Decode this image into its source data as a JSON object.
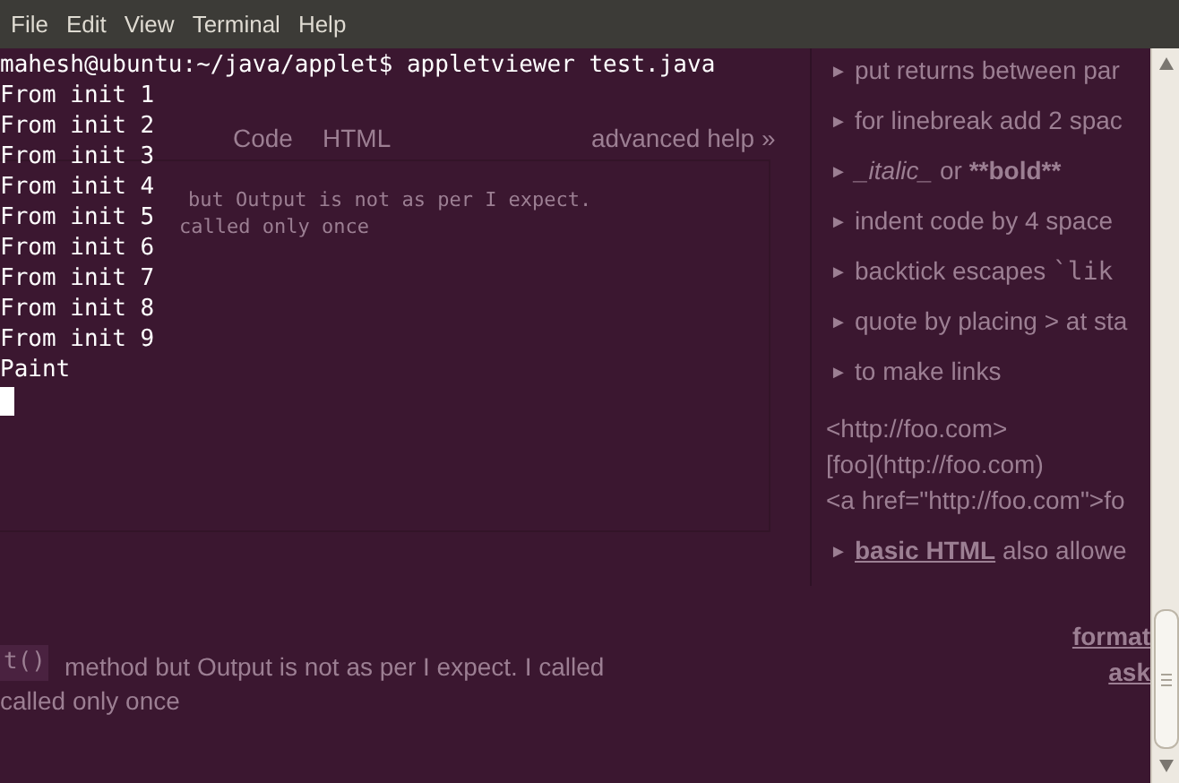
{
  "menu": [
    "File",
    "Edit",
    "View",
    "Terminal",
    "Help"
  ],
  "terminal": {
    "lines": [
      "mahesh@ubuntu:~/java/applet$ appletviewer test.java",
      "From init 1",
      "From init 2",
      "From init 3",
      "From init 4",
      "From init 5",
      "From init 6",
      "From init 7",
      "From init 8",
      "From init 9",
      "Paint"
    ],
    "cursor": true
  },
  "behind": {
    "tabs": [
      "Code",
      "HTML"
    ],
    "advanced_help": "advanced help »",
    "preview_lines": [
      "but Output is not as per I expect.",
      "called only once"
    ],
    "question_code": "t()",
    "question_lines": [
      "method but Output is not as per I expect. I called",
      "called only once"
    ],
    "help_items": [
      {
        "kind": "text",
        "marker": "►",
        "parts": [
          {
            "kind": "plain",
            "text": "put returns between par"
          }
        ]
      },
      {
        "kind": "text",
        "marker": "►",
        "parts": [
          {
            "kind": "plain",
            "text": "for linebreak add 2 spac"
          }
        ]
      },
      {
        "kind": "text",
        "marker": "►",
        "parts": [
          {
            "kind": "italic",
            "text": "_italic_"
          },
          {
            "kind": "plain",
            "text": " or "
          },
          {
            "kind": "bold",
            "text": "**bold**"
          }
        ]
      },
      {
        "kind": "text",
        "marker": "►",
        "parts": [
          {
            "kind": "plain",
            "text": "indent code by 4 space"
          }
        ]
      },
      {
        "kind": "text",
        "marker": "►",
        "parts": [
          {
            "kind": "plain",
            "text": "backtick escapes "
          },
          {
            "kind": "code",
            "text": "`lik"
          }
        ]
      },
      {
        "kind": "text",
        "marker": "►",
        "parts": [
          {
            "kind": "plain",
            "text": "quote by placing > at sta"
          }
        ]
      },
      {
        "kind": "text",
        "marker": "►",
        "parts": [
          {
            "kind": "plain",
            "text": "to make links"
          }
        ]
      },
      {
        "kind": "links",
        "lines": [
          "<http://foo.com>",
          "[foo](http://foo.com)",
          "<a href=\"http://foo.com\">fo"
        ]
      },
      {
        "kind": "text",
        "marker": "►",
        "parts": [
          {
            "kind": "link",
            "text": "basic HTML"
          },
          {
            "kind": "plain",
            "text": " also allowe"
          }
        ]
      }
    ],
    "footer_links": [
      "format",
      "ask"
    ]
  }
}
